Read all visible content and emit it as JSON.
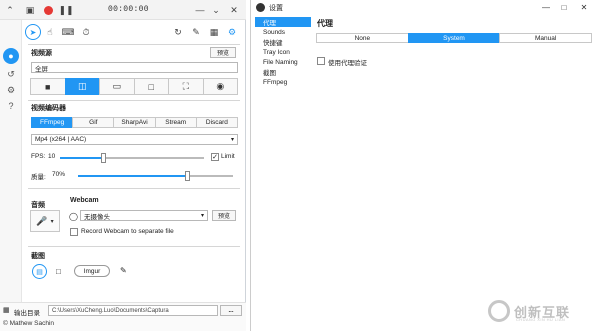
{
  "app": {
    "timer": "00:00:00",
    "video_source": {
      "title": "视频源",
      "preview_label": "预览",
      "value": "全屏"
    },
    "video_encoder": {
      "title": "视频编码器",
      "codecs": [
        "FFmpeg",
        "Gif",
        "SharpAvi",
        "Stream",
        "Discard"
      ],
      "active_codec": "FFmpeg",
      "format": "Mp4 (x264 | AAC)",
      "fps_label": "FPS:",
      "fps_value": "10",
      "fps_fraction": 0.3,
      "limit_label": "Limit",
      "limit_checked": true,
      "quality_label": "质量:",
      "quality_value": "70%",
      "quality_fraction": 0.7
    },
    "audio": {
      "title": "音频"
    },
    "webcam": {
      "title": "Webcam",
      "value": "无摄像头",
      "preview_label": "预览",
      "separate_label": "Record Webcam to separate file",
      "separate_checked": false
    },
    "screenshot": {
      "title": "截图",
      "imgur_label": "Imgur"
    },
    "output": {
      "label": "输出目录",
      "path": "C:\\Users\\XuCheng.Luo\\Documents\\Captura",
      "more_label": "..."
    },
    "author": "© Mathew Sachin"
  },
  "settings": {
    "window_title": "设置",
    "nav": [
      "代理",
      "Sounds",
      "快捷键",
      "Tray Icon",
      "File Naming",
      "截图",
      "FFmpeg"
    ],
    "active_nav": "代理",
    "panel_title": "代理",
    "proxy_modes": [
      "None",
      "System",
      "Manual"
    ],
    "active_proxy_mode": "System",
    "auth_label": "使用代理验证",
    "auth_checked": false
  },
  "watermark": {
    "text": "创新互联",
    "subtext": "CHUANG XIN HU LIAN"
  },
  "colors": {
    "accent": "#2196f3",
    "record": "#e53935"
  }
}
